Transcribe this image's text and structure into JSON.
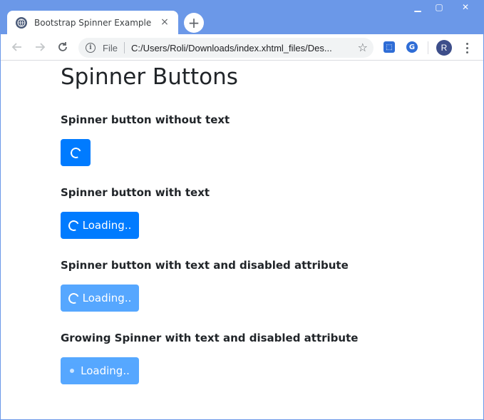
{
  "browser": {
    "tab_title": "Bootstrap Spinner Example",
    "tab_close": "×",
    "new_tab": "+",
    "file_chip": "File",
    "url": "C:/Users/Roli/Downloads/index.xhtml_files/Des...",
    "avatar_initial": "R",
    "window_controls": {
      "minimize": "▁",
      "maximize": "▢",
      "close": "✕"
    }
  },
  "page": {
    "heading": "Spinner Buttons",
    "sections": [
      {
        "title": "Spinner button without text",
        "button_label": "",
        "spinner": "border",
        "disabled": false
      },
      {
        "title": "Spinner button with text",
        "button_label": "Loading..",
        "spinner": "border",
        "disabled": false
      },
      {
        "title": "Spinner button with text and disabled attribute",
        "button_label": "Loading..",
        "spinner": "border",
        "disabled": true
      },
      {
        "title": "Growing Spinner with text and disabled attribute",
        "button_label": "Loading..",
        "spinner": "grow",
        "disabled": true
      }
    ]
  },
  "colors": {
    "primary": "#007bff",
    "primary_disabled": "#4da3ff",
    "title_bar": "#6b98e8",
    "text": "#212529"
  }
}
